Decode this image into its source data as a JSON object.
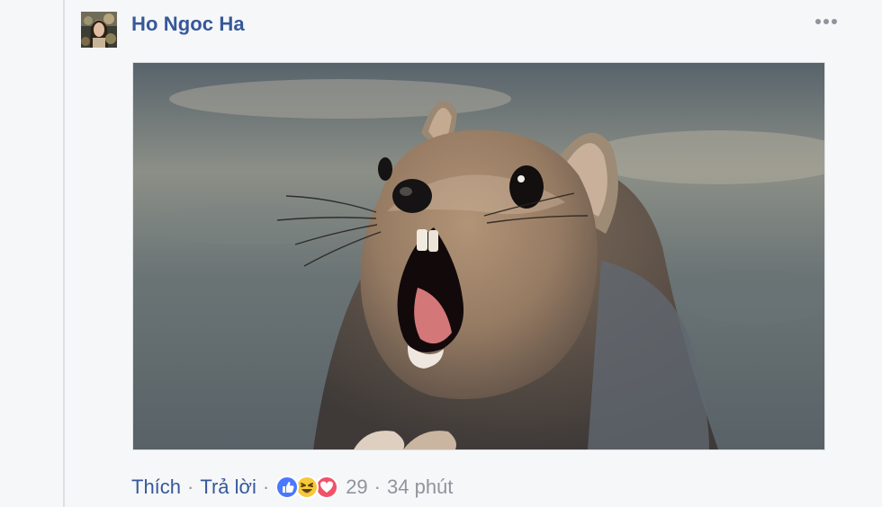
{
  "comment": {
    "author": "Ho Ngoc Ha",
    "photo_alt": "squirrel",
    "actions": {
      "like_label": "Thích",
      "reply_label": "Trả lời",
      "separator": "·",
      "reaction_count": "29",
      "timestamp": "34 phút"
    },
    "reactions": [
      "like-icon",
      "haha-icon",
      "love-icon"
    ],
    "more_icon": "more-dots-icon"
  },
  "colors": {
    "link": "#365899",
    "meta": "#90949c",
    "background": "#f6f7f9",
    "like": "#4a78ff",
    "haha": "#f7c83b",
    "love": "#f25268"
  }
}
